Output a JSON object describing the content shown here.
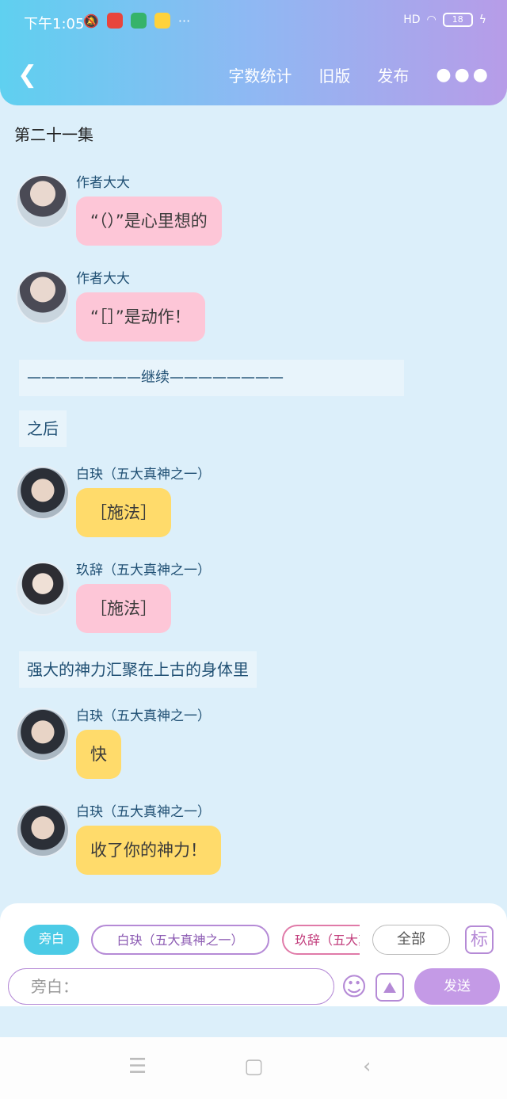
{
  "status": {
    "time": "下午1:05",
    "more": "···",
    "network": "HD",
    "battery": "18"
  },
  "header": {
    "back_icon": "chevron-left-icon",
    "word_count": "字数统计",
    "old_version": "旧版",
    "publish": "发布",
    "more": "●●●"
  },
  "chapter_title": "第二十一集",
  "messages": [
    {
      "speaker": "作者大大",
      "text": "“（）”是心里想的"
    },
    {
      "speaker": "作者大大",
      "text": "“［］”是动作！"
    },
    {
      "speaker": "白玦（五大真神之一）",
      "text": "［施法］"
    },
    {
      "speaker": "玖辞（五大真神之一）",
      "text": "［施法］"
    },
    {
      "speaker": "白玦（五大真神之一）",
      "text": "快"
    },
    {
      "speaker": "白玦（五大真神之一）",
      "text": "收了你的神力！"
    }
  ],
  "narration": [
    "————————继续————————",
    "之后",
    "强大的神力汇聚在上古的身体里"
  ],
  "composer": {
    "chip_narrator": "旁白",
    "chip_baijue": "白玦（五大真神之一）",
    "chip_jiuci": "玖辞（五大真神之一）",
    "chip_all": "全部",
    "mark_label": "标",
    "input_placeholder": "旁白：",
    "send": "发送"
  },
  "colors": {
    "pink_bubble": "#fdc6d7",
    "yellow_bubble": "#ffdb6b",
    "accent_purple": "#c49ae6",
    "accent_cyan": "#4ccbe6"
  }
}
